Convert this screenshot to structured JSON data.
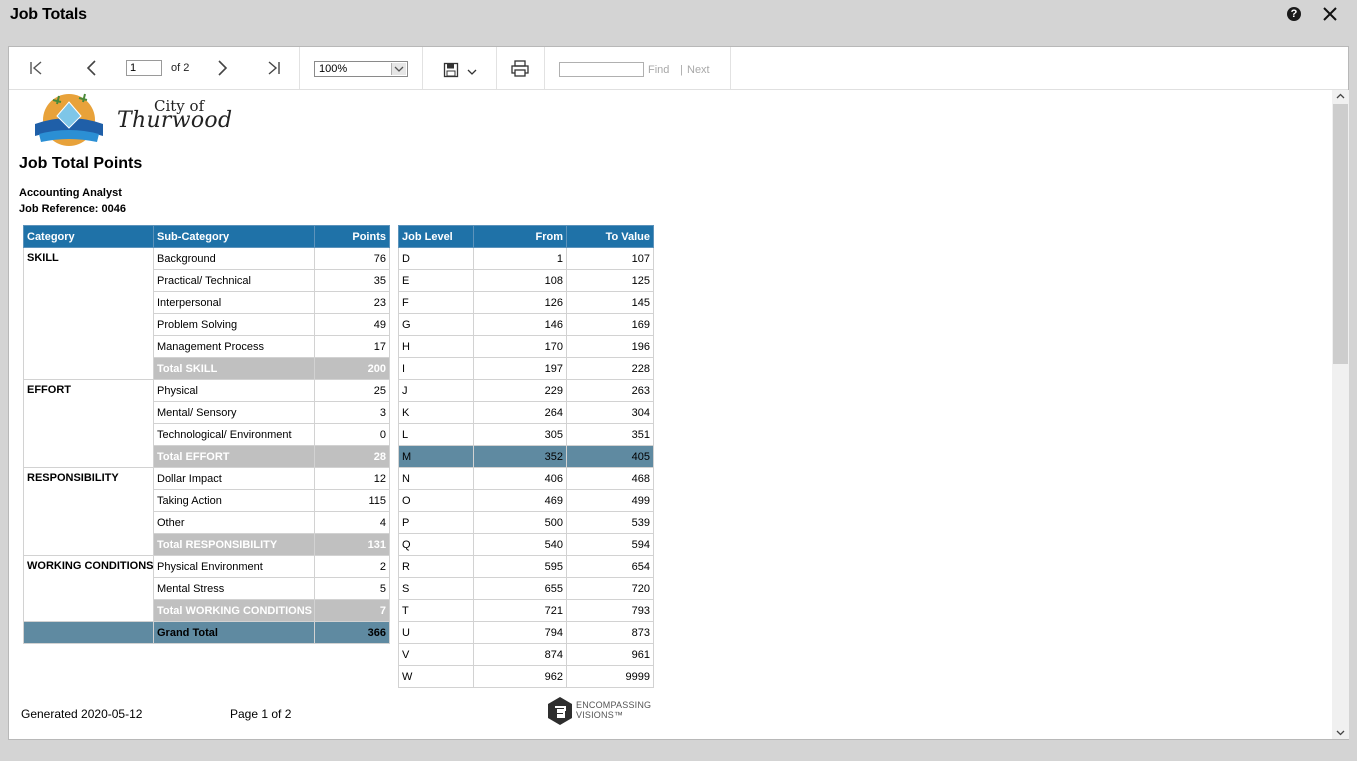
{
  "window": {
    "title": "Job Totals"
  },
  "toolbar": {
    "page_current": "1",
    "page_of": "of 2",
    "zoom": "100%",
    "find_label": "Find",
    "find_separator": "|",
    "next_label": "Next"
  },
  "report": {
    "logo": {
      "line1": "City of",
      "line2": "Thurwood"
    },
    "title": "Job Total Points",
    "job_name": "Accounting Analyst",
    "job_reference": "Job Reference: 0046",
    "points_table": {
      "headers": {
        "category": "Category",
        "subcategory": "Sub-Category",
        "points": "Points"
      },
      "groups": [
        {
          "category": "SKILL",
          "rows": [
            {
              "sub": "Background",
              "points": "76"
            },
            {
              "sub": "Practical/ Technical",
              "points": "35"
            },
            {
              "sub": "Interpersonal",
              "points": "23"
            },
            {
              "sub": "Problem Solving",
              "points": "49"
            },
            {
              "sub": "Management Process",
              "points": "17"
            }
          ],
          "total_label": "Total SKILL",
          "total_points": "200"
        },
        {
          "category": "EFFORT",
          "rows": [
            {
              "sub": "Physical",
              "points": "25"
            },
            {
              "sub": "Mental/ Sensory",
              "points": "3"
            },
            {
              "sub": "Technological/ Environment",
              "points": "0"
            }
          ],
          "total_label": "Total EFFORT",
          "total_points": "28"
        },
        {
          "category": "RESPONSIBILITY",
          "rows": [
            {
              "sub": "Dollar Impact",
              "points": "12"
            },
            {
              "sub": "Taking Action",
              "points": "115"
            },
            {
              "sub": "Other",
              "points": "4"
            }
          ],
          "total_label": "Total RESPONSIBILITY",
          "total_points": "131"
        },
        {
          "category": "WORKING CONDITIONS",
          "rows": [
            {
              "sub": "Physical Environment",
              "points": "2"
            },
            {
              "sub": "Mental Stress",
              "points": "5"
            }
          ],
          "total_label": "Total WORKING CONDITIONS",
          "total_points": "7"
        }
      ],
      "grand_total_label": "Grand Total",
      "grand_total": "366"
    },
    "levels_table": {
      "headers": {
        "level": "Job Level",
        "from": "From",
        "to": "To Value"
      },
      "highlighted_level": "M",
      "rows": [
        {
          "level": "D",
          "from": "1",
          "to": "107"
        },
        {
          "level": "E",
          "from": "108",
          "to": "125"
        },
        {
          "level": "F",
          "from": "126",
          "to": "145"
        },
        {
          "level": "G",
          "from": "146",
          "to": "169"
        },
        {
          "level": "H",
          "from": "170",
          "to": "196"
        },
        {
          "level": "I",
          "from": "197",
          "to": "228"
        },
        {
          "level": "J",
          "from": "229",
          "to": "263"
        },
        {
          "level": "K",
          "from": "264",
          "to": "304"
        },
        {
          "level": "L",
          "from": "305",
          "to": "351"
        },
        {
          "level": "M",
          "from": "352",
          "to": "405"
        },
        {
          "level": "N",
          "from": "406",
          "to": "468"
        },
        {
          "level": "O",
          "from": "469",
          "to": "499"
        },
        {
          "level": "P",
          "from": "500",
          "to": "539"
        },
        {
          "level": "Q",
          "from": "540",
          "to": "594"
        },
        {
          "level": "R",
          "from": "595",
          "to": "654"
        },
        {
          "level": "S",
          "from": "655",
          "to": "720"
        },
        {
          "level": "T",
          "from": "721",
          "to": "793"
        },
        {
          "level": "U",
          "from": "794",
          "to": "873"
        },
        {
          "level": "V",
          "from": "874",
          "to": "961"
        },
        {
          "level": "W",
          "from": "962",
          "to": "9999"
        }
      ]
    },
    "footer": {
      "generated": "Generated 2020-05-12",
      "page": "Page 1 of 2",
      "brand_line1": "ENCOMPASSING",
      "brand_line2": "VISIONS™"
    }
  },
  "colors": {
    "header_blue": "#1f72a8",
    "total_gray": "#c0c0c0",
    "highlight_steel": "#5f8aa1"
  }
}
